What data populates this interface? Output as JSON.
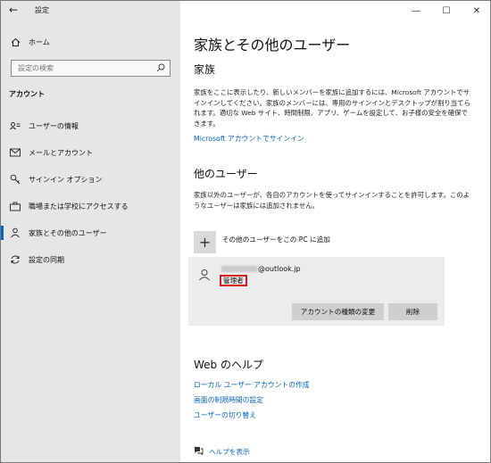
{
  "window": {
    "app_title": "設定",
    "controls": {
      "minimize": "—",
      "maximize": "☐",
      "close": "✕"
    }
  },
  "sidebar": {
    "back_glyph": "←",
    "home": {
      "label": "ホーム",
      "icon": "home-icon"
    },
    "search": {
      "placeholder": "設定の検索",
      "icon": "search-icon"
    },
    "section": "アカウント",
    "items": [
      {
        "label": "ユーザーの情報",
        "icon": "user-info-icon",
        "active": false
      },
      {
        "label": "メールとアカウント",
        "icon": "mail-icon",
        "active": false
      },
      {
        "label": "サインイン オプション",
        "icon": "key-icon",
        "active": false
      },
      {
        "label": "職場または学校にアクセスする",
        "icon": "briefcase-icon",
        "active": false
      },
      {
        "label": "家族とその他のユーザー",
        "icon": "family-icon",
        "active": true
      },
      {
        "label": "設定の同期",
        "icon": "sync-icon",
        "active": false
      }
    ]
  },
  "main": {
    "title": "家族とその他のユーザー",
    "family": {
      "heading": "家族",
      "description": "家族をここに表示したり、新しいメンバーを家族に追加するには、Microsoft アカウントでサインインしてください。家族のメンバーには、専用のサインインとデスクトップが割り当てられます。適切な Web サイト、時間制限、アプリ、ゲームを設定して、お子様の安全を確保できます。",
      "signin_link": "Microsoft アカウントでサインイン"
    },
    "other_users": {
      "heading": "他のユーザー",
      "description": "家族以外のユーザーが、各自のアカウントを使ってサインインすることを許可します。このようなユーザーは家族には追加されません。",
      "add_button_glyph": "+",
      "add_label": "その他のユーザーをこの PC に追加",
      "account": {
        "email_suffix": "@outlook.jp",
        "role": "管理者",
        "change_type_button": "アカウントの種類の変更",
        "delete_button": "削除"
      }
    },
    "web_help": {
      "heading": "Web のヘルプ",
      "links": [
        "ローカル ユーザー アカウントの作成",
        "画面の制限時間の設定",
        "ユーザーの切り替え"
      ]
    },
    "show_help": "ヘルプを表示"
  }
}
